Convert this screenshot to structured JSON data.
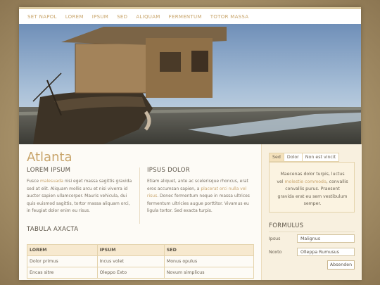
{
  "nav": [
    "Set napol",
    "Lorem",
    "Ipsum",
    "Sed",
    "Aliquam",
    "Fermentum",
    "Totor massa"
  ],
  "page_title": "Atlanta",
  "col1": {
    "heading": "LOREM IPSUM",
    "text_a": "Fusce ",
    "highlight": "malesuada",
    "text_b": " nisi eget massa sagittis gravida sed at elit. Aliquam mollis arcu et nisi viverra id auctor sapien ullamcorper. Mauris vehicula, dui quis euismod sagittis, tortor massa aliquam orci, in feugiat dolor enim eu risus."
  },
  "col2": {
    "heading": "IPSUS DOLOR",
    "text_a": "Etiam aliquet, ante ac scelerisque rhoncus, erat eros accumsan sapien, a ",
    "highlight": "placerat orci nulla vel risus",
    "text_b": ". Donec fermentum neque in massa ultrices fermentum ultricies augue porttitor. Vivamus eu ligula tortor. Sed exacta turpis."
  },
  "table": {
    "heading": "TABULA AXACTA",
    "columns": [
      "LOREM",
      "IPSUM",
      "SED"
    ],
    "rows": [
      [
        "Dolor primus",
        "Incus volet",
        "Monus opulus"
      ],
      [
        "Encas sitre",
        "Oleppo Exto",
        "Novum simplicus"
      ]
    ]
  },
  "sidebar": {
    "tabs": [
      "Sed",
      "Dolor",
      "Non est vincit"
    ],
    "tab_text_a": "Maecenas dolor turpis, luctus vel ",
    "tab_highlight": "molestie commodo",
    "tab_text_b": ", convallis convallis purus. Praesent gravida erat eu sem vestibulum semper.",
    "form_title": "FORMULUS",
    "label1": "Ipsus",
    "value1": "Malignus",
    "label2": "Noxto",
    "value2": "Olleppa Rumusus",
    "button": "Absenden"
  },
  "colors": {
    "accent": "#c8a46a",
    "heading": "#5b5346",
    "header_bg": "#f7e9cf"
  }
}
